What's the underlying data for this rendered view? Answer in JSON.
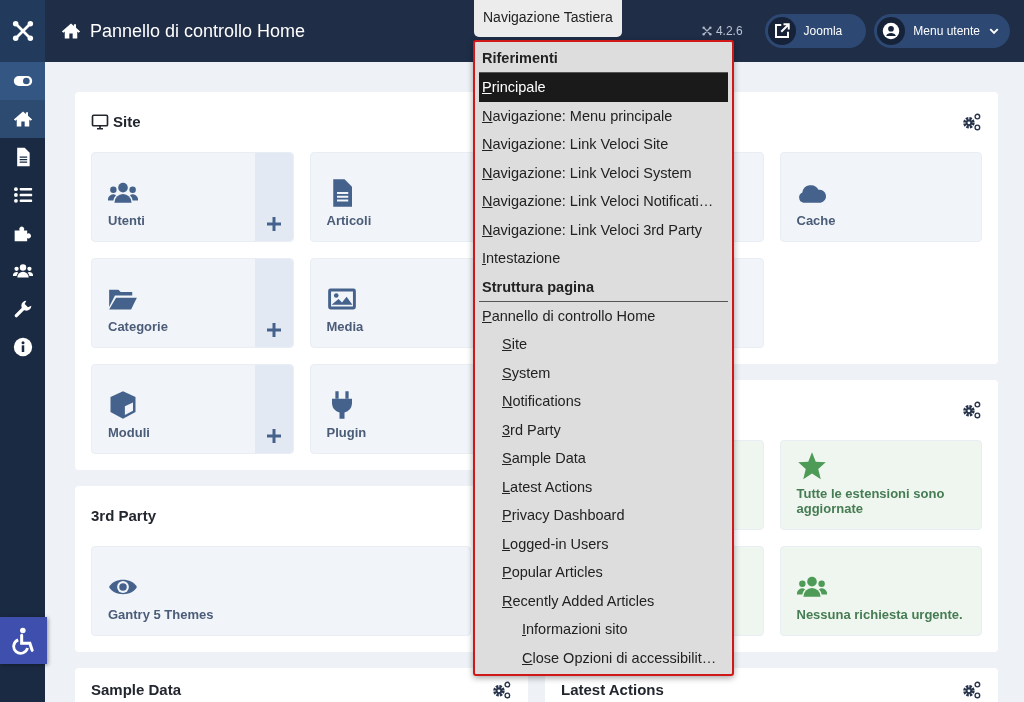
{
  "sidebar": {
    "items": [
      {
        "selected": true
      },
      {
        "selected": false
      },
      {
        "selected": false
      },
      {
        "selected": false
      },
      {
        "selected": false
      },
      {
        "selected": false
      },
      {
        "selected": false
      }
    ]
  },
  "header": {
    "title": "Pannello di controllo Home",
    "version": "4.2.6",
    "buttons": [
      {
        "label": "Joomla",
        "kind": "link"
      },
      {
        "label": "Menu utente",
        "kind": "dropdown"
      }
    ]
  },
  "columns": [
    [
      {
        "title": "Site",
        "title_icon": true,
        "tiles": [
          {
            "kind": "link",
            "label": "Utenti",
            "add": true
          },
          {
            "kind": "link",
            "label": "Articoli"
          },
          {
            "kind": "link",
            "label": "Categorie",
            "add": true
          },
          {
            "kind": "link",
            "label": "Media"
          },
          {
            "kind": "link",
            "label": "Moduli",
            "add": true
          },
          {
            "kind": "link",
            "label": "Plugin"
          }
        ]
      },
      {
        "title": "3rd Party",
        "tiles": [
          {
            "kind": "link",
            "label": "Gantry 5 Themes"
          }
        ]
      },
      {
        "title": "Sample Data",
        "settings": true
      }
    ],
    [
      {
        "settings": true,
        "tiles": [
          {
            "kind": "link"
          },
          {
            "kind": "link",
            "label": "Cache"
          },
          {
            "kind": "link"
          }
        ]
      },
      {
        "settings": true,
        "tiles": [
          {
            "kind": "status"
          },
          {
            "kind": "status",
            "label": "Tutte le estensioni sono aggiornate"
          },
          {
            "kind": "status"
          },
          {
            "kind": "status",
            "label": "Nessuna richiesta urgente."
          }
        ]
      },
      {
        "title": "Latest Actions",
        "settings": true
      }
    ]
  ],
  "keyboard_nav": {
    "tab": "Navigazione Tastiera",
    "items": [
      {
        "kind": "heading",
        "label": "Riferimenti"
      },
      {
        "kind": "link",
        "label": "Principale",
        "selected": true
      },
      {
        "kind": "link",
        "label": "Navigazione: Menu principale",
        "selected": false
      },
      {
        "kind": "link",
        "label": "Navigazione: Link Veloci Site",
        "selected": false
      },
      {
        "kind": "link",
        "label": "Navigazione: Link Veloci System",
        "selected": false
      },
      {
        "kind": "link",
        "label": "Navigazione: Link Veloci Notificati…",
        "selected": false
      },
      {
        "kind": "link",
        "label": "Navigazione: Link Veloci 3rd Party",
        "selected": false
      },
      {
        "kind": "link",
        "label": "Intestazione",
        "selected": false
      },
      {
        "kind": "heading",
        "label": "Struttura pagina"
      },
      {
        "kind": "link",
        "label": "Pannello di controllo Home",
        "selected": false,
        "children": [
          {
            "kind": "link",
            "label": "Site",
            "selected": false
          },
          {
            "kind": "link",
            "label": "System",
            "selected": false
          },
          {
            "kind": "link",
            "label": "Notifications",
            "selected": false
          },
          {
            "kind": "link",
            "label": "3rd Party",
            "selected": false
          },
          {
            "kind": "link",
            "label": "Sample Data",
            "selected": false
          },
          {
            "kind": "link",
            "label": "Latest Actions",
            "selected": false
          },
          {
            "kind": "link",
            "label": "Privacy Dashboard",
            "selected": false
          },
          {
            "kind": "link",
            "label": "Logged-in Users",
            "selected": false
          },
          {
            "kind": "link",
            "label": "Popular Articles",
            "selected": false
          },
          {
            "kind": "link",
            "label": "Recently Added Articles",
            "selected": false,
            "children": [
              {
                "kind": "link",
                "label": "Informazioni sito",
                "selected": false
              },
              {
                "kind": "link",
                "label": "Close Opzioni di accessibilit…",
                "selected": false
              }
            ]
          }
        ]
      }
    ]
  }
}
